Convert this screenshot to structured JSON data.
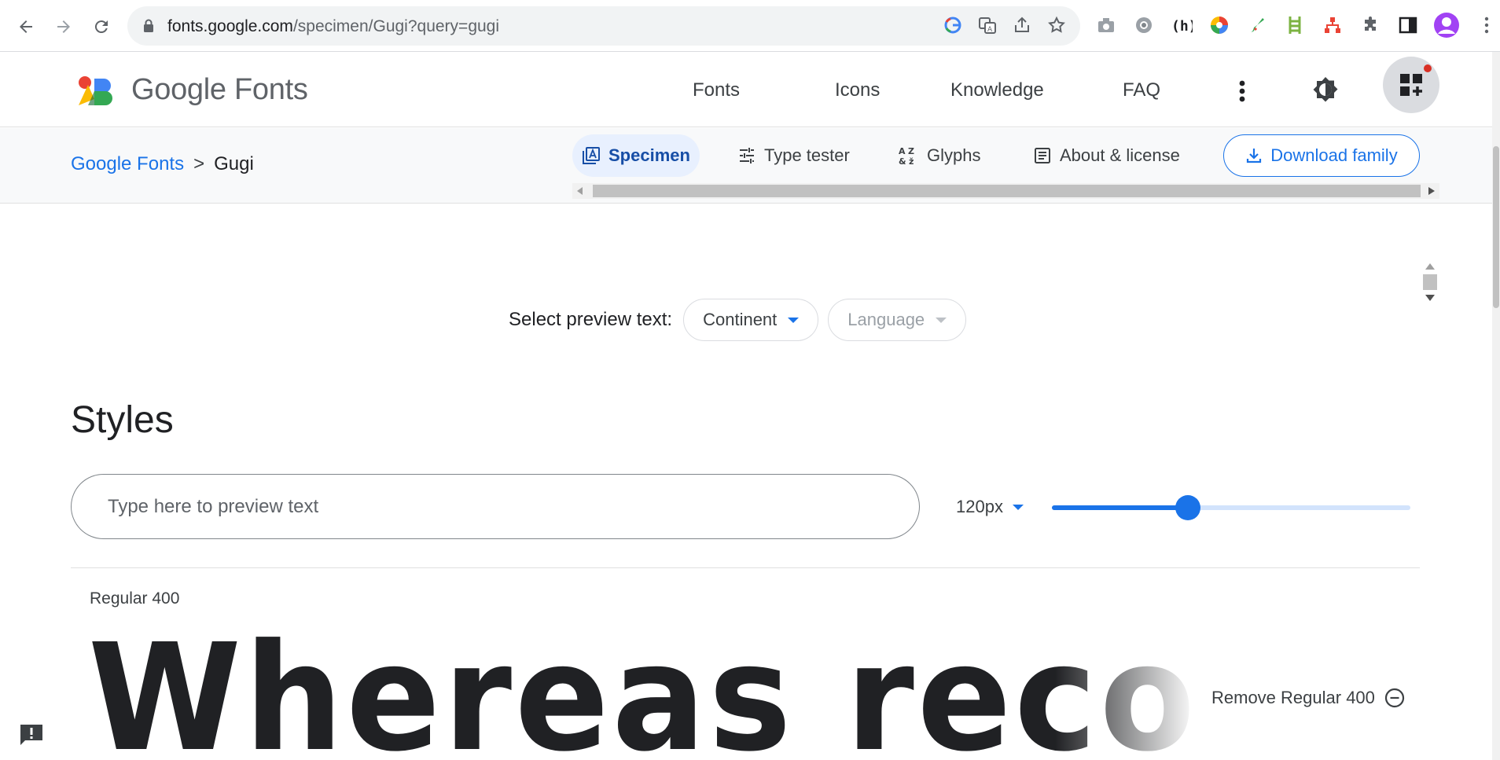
{
  "browser": {
    "url_host": "fonts.google.com",
    "url_path": "/specimen/Gugi?query=gugi"
  },
  "header": {
    "logo_text": "Google Fonts",
    "nav": [
      "Fonts",
      "Icons",
      "Knowledge",
      "FAQ"
    ]
  },
  "subheader": {
    "breadcrumb_root": "Google Fonts",
    "breadcrumb_sep": ">",
    "breadcrumb_current": "Gugi",
    "tabs": [
      "Specimen",
      "Type tester",
      "Glyphs",
      "About & license"
    ],
    "active_tab": "Specimen",
    "download_label": "Download family"
  },
  "main": {
    "preview_label": "Select preview text:",
    "continent_label": "Continent",
    "language_label": "Language",
    "styles_title": "Styles",
    "preview_placeholder": "Type here to preview text",
    "size_value": "120px",
    "slider_fraction": 0.38,
    "style_name": "Regular 400",
    "specimen_text": "Whereas recogr",
    "remove_label": "Remove Regular 400"
  },
  "colors": {
    "accent": "#1a73e8",
    "active_tab_bg": "#e8f0fe",
    "subheader_bg": "#f8f9fa"
  }
}
